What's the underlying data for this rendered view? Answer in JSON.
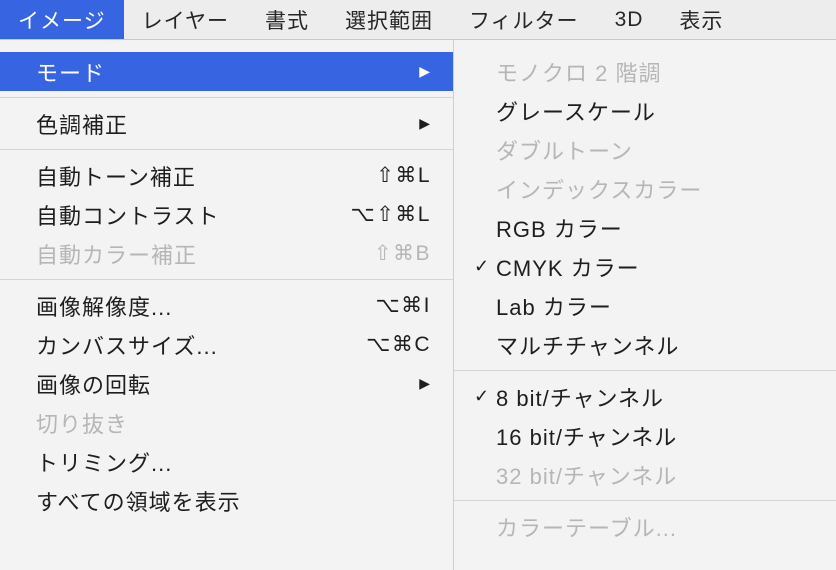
{
  "menubar": {
    "items": [
      {
        "label": "イメージ",
        "active": true
      },
      {
        "label": "レイヤー",
        "active": false
      },
      {
        "label": "書式",
        "active": false
      },
      {
        "label": "選択範囲",
        "active": false
      },
      {
        "label": "フィルター",
        "active": false
      },
      {
        "label": "3D",
        "active": false
      },
      {
        "label": "表示",
        "active": false
      }
    ]
  },
  "image_menu": {
    "groups": [
      [
        {
          "label": "モード",
          "shortcut": "",
          "arrow": true,
          "highlighted": true,
          "disabled": false
        }
      ],
      [
        {
          "label": "色調補正",
          "shortcut": "",
          "arrow": true,
          "highlighted": false,
          "disabled": false
        }
      ],
      [
        {
          "label": "自動トーン補正",
          "shortcut": "⇧⌘L",
          "arrow": false,
          "highlighted": false,
          "disabled": false
        },
        {
          "label": "自動コントラスト",
          "shortcut": "⌥⇧⌘L",
          "arrow": false,
          "highlighted": false,
          "disabled": false
        },
        {
          "label": "自動カラー補正",
          "shortcut": "⇧⌘B",
          "arrow": false,
          "highlighted": false,
          "disabled": true
        }
      ],
      [
        {
          "label": "画像解像度...",
          "shortcut": "⌥⌘I",
          "arrow": false,
          "highlighted": false,
          "disabled": false
        },
        {
          "label": "カンバスサイズ...",
          "shortcut": "⌥⌘C",
          "arrow": false,
          "highlighted": false,
          "disabled": false
        },
        {
          "label": "画像の回転",
          "shortcut": "",
          "arrow": true,
          "highlighted": false,
          "disabled": false
        },
        {
          "label": "切り抜き",
          "shortcut": "",
          "arrow": false,
          "highlighted": false,
          "disabled": true
        },
        {
          "label": "トリミング...",
          "shortcut": "",
          "arrow": false,
          "highlighted": false,
          "disabled": false
        },
        {
          "label": "すべての領域を表示",
          "shortcut": "",
          "arrow": false,
          "highlighted": false,
          "disabled": false
        }
      ]
    ]
  },
  "mode_submenu": {
    "groups": [
      [
        {
          "label": "モノクロ 2 階調",
          "checked": false,
          "disabled": true
        },
        {
          "label": "グレースケール",
          "checked": false,
          "disabled": false
        },
        {
          "label": "ダブルトーン",
          "checked": false,
          "disabled": true
        },
        {
          "label": "インデックスカラー",
          "checked": false,
          "disabled": true
        },
        {
          "label": "RGB カラー",
          "checked": false,
          "disabled": false
        },
        {
          "label": "CMYK カラー",
          "checked": true,
          "disabled": false
        },
        {
          "label": "Lab カラー",
          "checked": false,
          "disabled": false
        },
        {
          "label": "マルチチャンネル",
          "checked": false,
          "disabled": false
        }
      ],
      [
        {
          "label": "8 bit/チャンネル",
          "checked": true,
          "disabled": false
        },
        {
          "label": "16 bit/チャンネル",
          "checked": false,
          "disabled": false
        },
        {
          "label": "32 bit/チャンネル",
          "checked": false,
          "disabled": true
        }
      ],
      [
        {
          "label": "カラーテーブル...",
          "checked": false,
          "disabled": true
        }
      ]
    ]
  }
}
